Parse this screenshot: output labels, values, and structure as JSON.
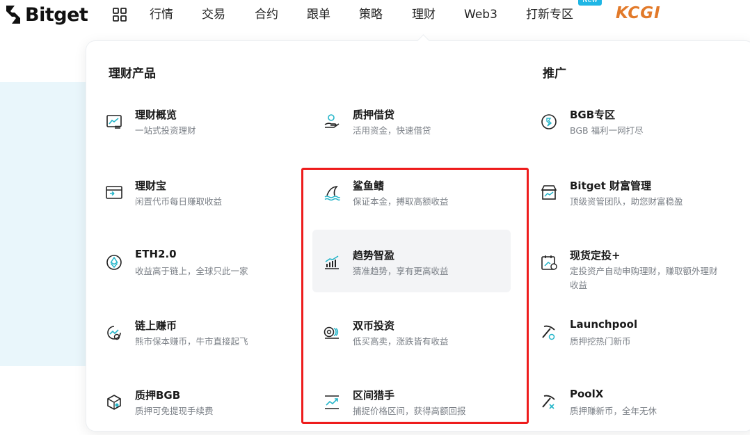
{
  "brand": {
    "name": "Bitget"
  },
  "nav": {
    "items": [
      "行情",
      "交易",
      "合约",
      "跟单",
      "策略",
      "理财",
      "Web3",
      "打新专区"
    ],
    "new_badge": "New",
    "partner_logo": "KCGI"
  },
  "panel": {
    "section_left": "理财产品",
    "section_right": "推广",
    "col1": [
      {
        "title": "理财概览",
        "desc": "一站式投资理财",
        "icon": "chart-board-icon"
      },
      {
        "title": "理财宝",
        "desc": "闲置代币每日赚取收益",
        "icon": "wallet-box-icon"
      },
      {
        "title": "ETH2.0",
        "desc": "收益高于链上，全球只此一家",
        "icon": "ethereum-icon"
      },
      {
        "title": "链上赚币",
        "desc": "熊市保本赚币，牛市直接起飞",
        "icon": "onchain-earn-icon"
      },
      {
        "title": "质押BGB",
        "desc": "质押可免提现手续费",
        "icon": "stake-cube-icon"
      }
    ],
    "col2": [
      {
        "title": "质押借贷",
        "desc": "活用资金，快速借贷",
        "icon": "coin-hand-icon"
      },
      {
        "title": "鲨鱼鳍",
        "desc": "保证本金，搏取高额收益",
        "icon": "shark-fin-icon"
      },
      {
        "title": "趋势智盈",
        "desc": "猜准趋势，享有更高收益",
        "icon": "trend-bars-icon"
      },
      {
        "title": "双币投资",
        "desc": "低买高卖，涨跌皆有收益",
        "icon": "dual-coin-icon"
      },
      {
        "title": "区间猎手",
        "desc": "捕捉价格区间，获得高额回报",
        "icon": "range-chart-icon"
      }
    ],
    "col3": [
      {
        "title": "BGB专区",
        "desc": "BGB 福利一网打尽",
        "icon": "bgb-coin-icon"
      },
      {
        "title": "Bitget 财富管理",
        "desc": "顶级资管团队，助您财富稳盈",
        "icon": "wealth-store-icon"
      },
      {
        "title": "现货定投+",
        "desc": "定投资产自动申购理财，赚取额外理财收益",
        "icon": "calendar-invest-icon"
      },
      {
        "title": "Launchpool",
        "desc": "质押挖热门新币",
        "icon": "pickaxe-icon"
      },
      {
        "title": "PoolX",
        "desc": "质押赚新币，全年无休",
        "icon": "poolx-pickaxe-icon"
      }
    ]
  },
  "colors": {
    "highlight": "#ee1c1c",
    "accent_teal": "#24b5c9",
    "badge": "#1fb6e5",
    "kcgi": "#e27a2a"
  }
}
